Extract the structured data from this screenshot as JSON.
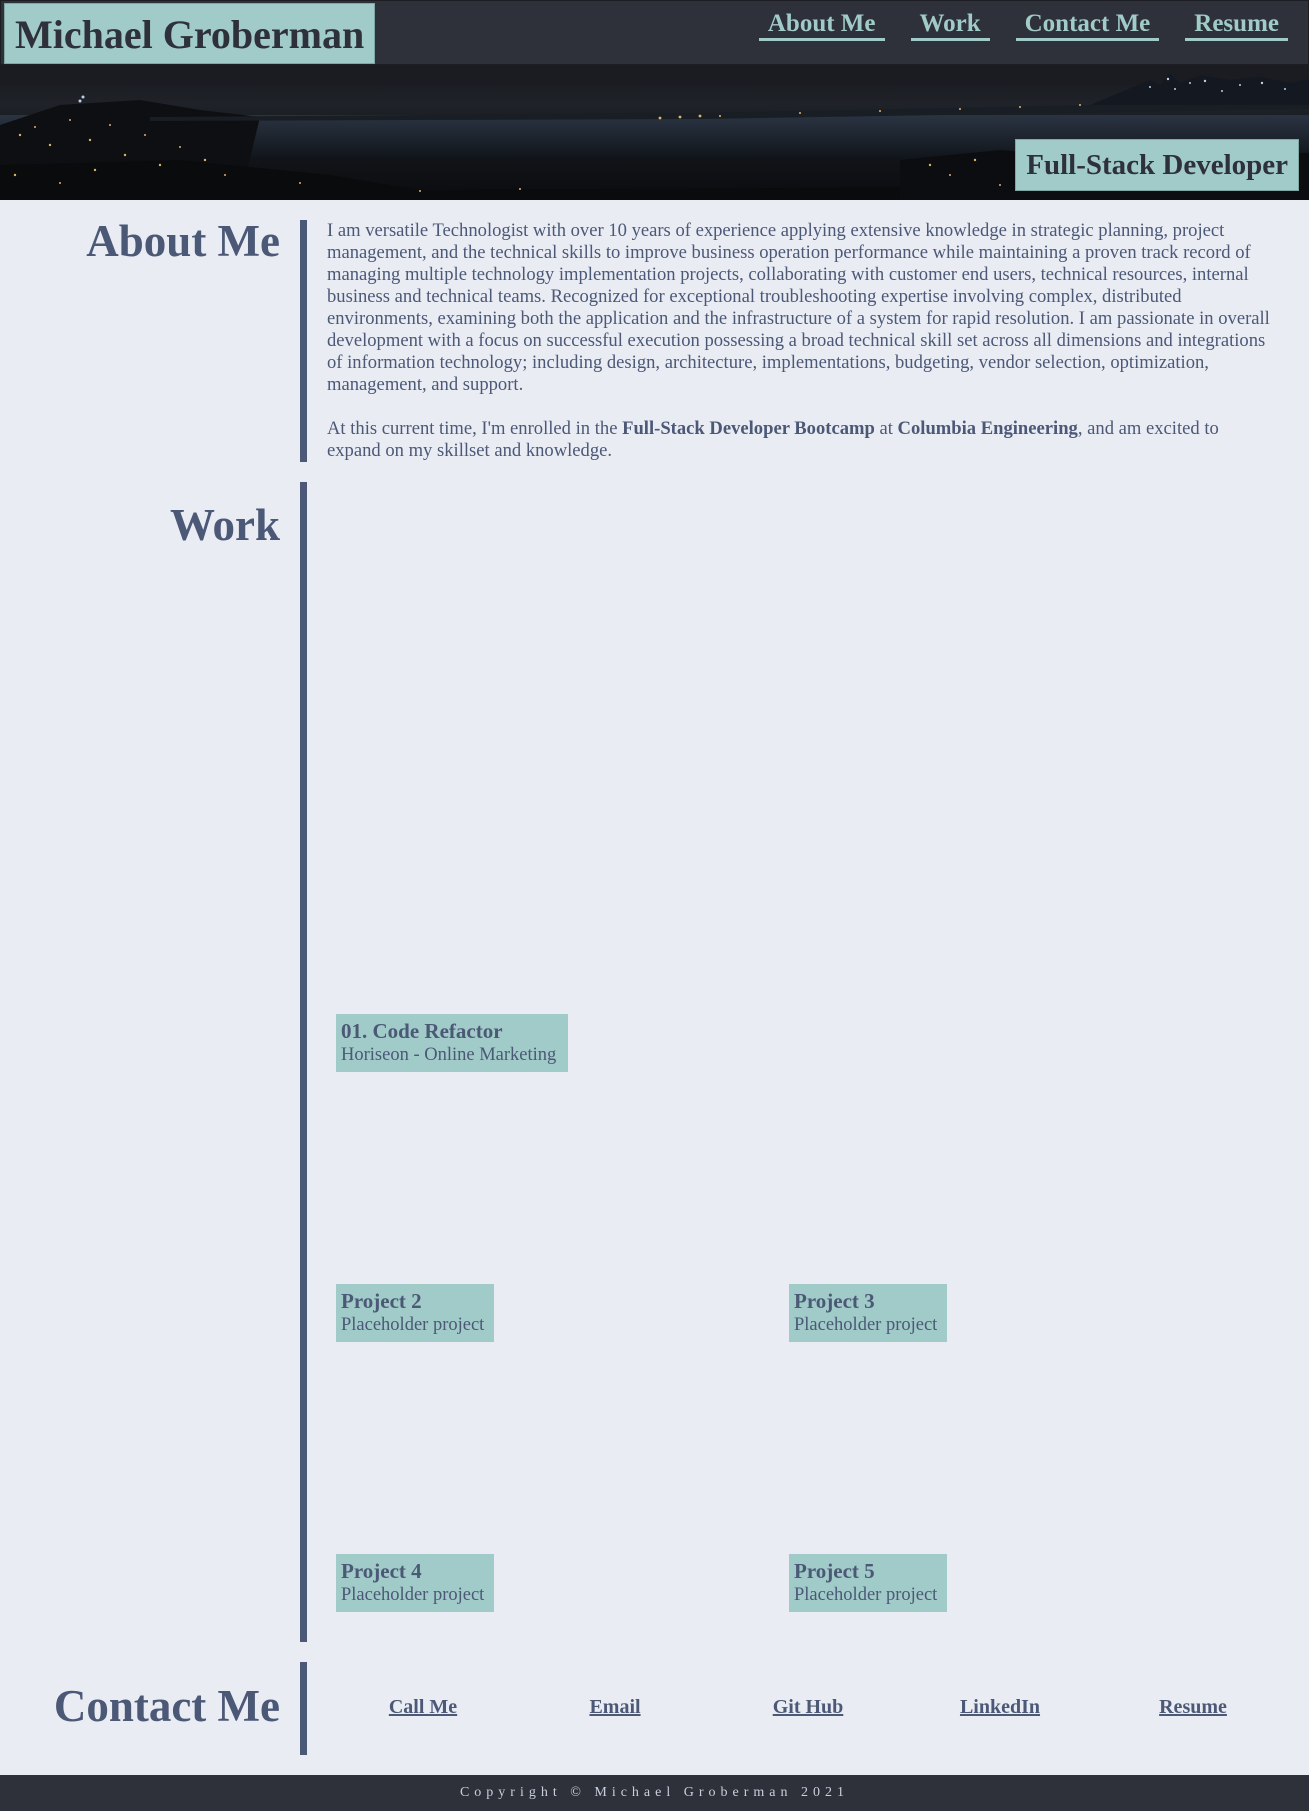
{
  "header": {
    "name": "Michael Groberman",
    "nav": [
      "About Me",
      "Work",
      "Contact Me",
      "Resume"
    ]
  },
  "hero": {
    "tagline": "Full-Stack Developer"
  },
  "about": {
    "title": "About Me",
    "paragraph1": "I am versatile Technologist with over 10 years of experience applying extensive knowledge in strategic planning, project management, and the technical skills to improve business operation performance while maintaining a proven track record of managing multiple technology implementation projects, collaborating with customer end users, technical resources, internal business and technical teams. Recognized for exceptional troubleshooting expertise involving complex, distributed environments, examining both the application and the infrastructure of a system for rapid resolution. I am passionate in overall development with a focus on successful execution possessing a broad technical skill set across all dimensions and integrations of information technology; including design, architecture, implementations, budgeting, vendor selection, optimization, management, and support.",
    "p2_before": "At this current time, I'm enrolled in the ",
    "p2_bold1": "Full-Stack Developer Bootcamp",
    "p2_mid": " at ",
    "p2_bold2": "Columbia Engineering",
    "p2_after": ", and am excited to expand on my skillset and knowledge."
  },
  "work": {
    "title": "Work",
    "projects": [
      {
        "title": "01. Code Refactor",
        "subtitle": "Horiseon - Online Marketing"
      },
      {
        "title": "Project 2",
        "subtitle": "Placeholder project"
      },
      {
        "title": "Project 3",
        "subtitle": "Placeholder project"
      },
      {
        "title": "Project 4",
        "subtitle": "Placeholder project"
      },
      {
        "title": "Project 5",
        "subtitle": "Placeholder project"
      }
    ]
  },
  "contact": {
    "title": "Contact Me",
    "links": [
      "Call Me",
      "Email",
      "Git Hub",
      "LinkedIn",
      "Resume"
    ]
  },
  "footer": {
    "copyright": "Copyright © Michael Groberman 2021"
  },
  "colors": {
    "accent": "#a1cbc8",
    "dark": "#2e3139",
    "text": "#4b5876",
    "background": "#eaecf4"
  }
}
